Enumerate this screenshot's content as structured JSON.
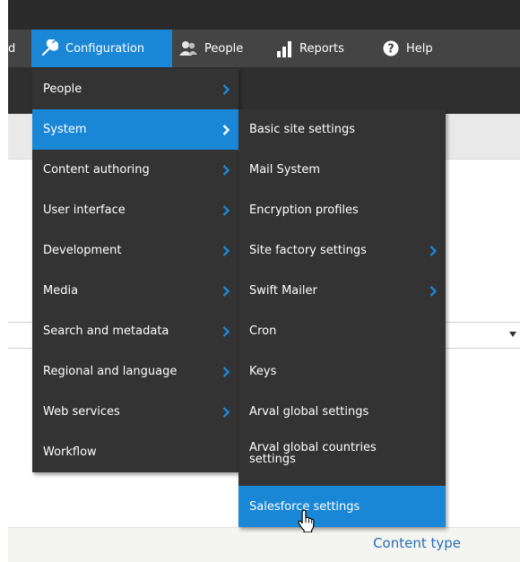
{
  "toolbar": {
    "truncated_label": "d",
    "configuration": "Configuration",
    "people": "People",
    "reports": "Reports",
    "help": "Help",
    "icons": {
      "configuration": "wrench-icon",
      "people": "people-icon",
      "reports": "bar-chart-icon",
      "help": "help-icon"
    }
  },
  "menu_primary": [
    {
      "label": "People",
      "has_submenu": true
    },
    {
      "label": "System",
      "has_submenu": true,
      "active": true
    },
    {
      "label": "Content authoring",
      "has_submenu": true
    },
    {
      "label": "User interface",
      "has_submenu": true
    },
    {
      "label": "Development",
      "has_submenu": true
    },
    {
      "label": "Media",
      "has_submenu": true
    },
    {
      "label": "Search and metadata",
      "has_submenu": true
    },
    {
      "label": "Regional and language",
      "has_submenu": true
    },
    {
      "label": "Web services",
      "has_submenu": true
    },
    {
      "label": "Workflow",
      "has_submenu": false
    }
  ],
  "menu_system": [
    {
      "label": "Basic site settings",
      "has_submenu": false
    },
    {
      "label": "Mail System",
      "has_submenu": false
    },
    {
      "label": "Encryption profiles",
      "has_submenu": false
    },
    {
      "label": "Site factory settings",
      "has_submenu": true
    },
    {
      "label": "Swift Mailer",
      "has_submenu": true
    },
    {
      "label": "Cron",
      "has_submenu": false
    },
    {
      "label": "Keys",
      "has_submenu": false
    },
    {
      "label": "Arval global settings",
      "has_submenu": false
    },
    {
      "label": "Arval global countries settings",
      "has_submenu": false
    },
    {
      "label": "Salesforce settings",
      "has_submenu": false,
      "active": true
    }
  ],
  "page": {
    "content_type_link": "Content type"
  },
  "colors": {
    "accent": "#1a87d6",
    "menu_bg": "#333333",
    "toolbar_bg": "#444444",
    "link": "#2770b8"
  }
}
